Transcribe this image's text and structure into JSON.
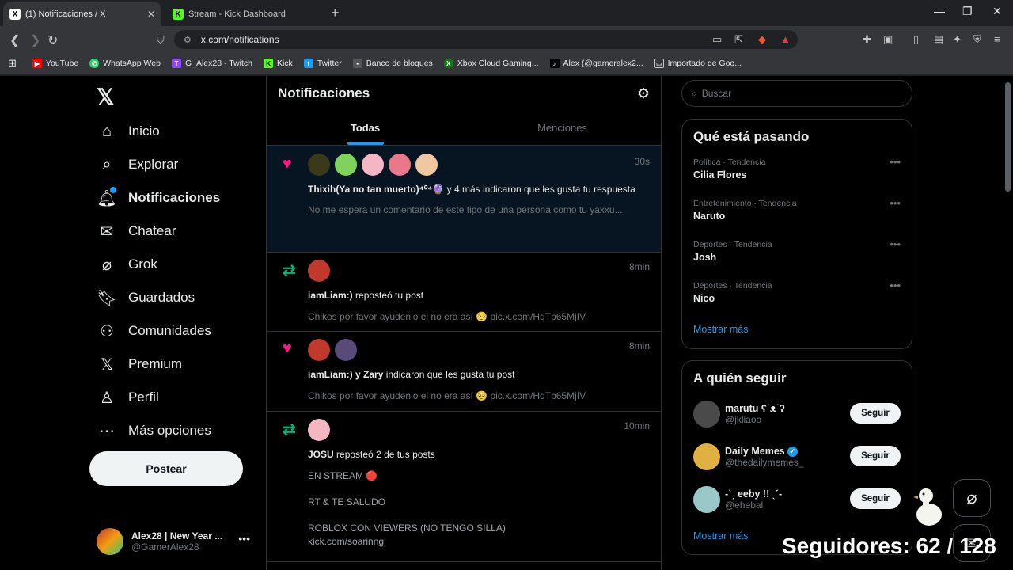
{
  "browser": {
    "tabs": [
      {
        "title": "(1) Notificaciones / X",
        "icon": "x-icon",
        "active": true
      },
      {
        "title": "Stream - Kick Dashboard",
        "icon": "kick-icon",
        "active": false
      }
    ],
    "url": "x.com/notifications",
    "bookmarks": [
      {
        "label": "YouTube",
        "icon": "youtube-icon",
        "color": "#ff0000"
      },
      {
        "label": "WhatsApp Web",
        "icon": "whatsapp-icon",
        "color": "#25d366"
      },
      {
        "label": "G_Alex28 - Twitch",
        "icon": "twitch-icon",
        "color": "#9146ff"
      },
      {
        "label": "Kick",
        "icon": "kick-icon",
        "color": "#53fc18"
      },
      {
        "label": "Twitter",
        "icon": "twitter-icon",
        "color": "#1d9bf0"
      },
      {
        "label": "Banco de bloques",
        "icon": "block-icon",
        "color": "#ffffff"
      },
      {
        "label": "Xbox Cloud Gaming...",
        "icon": "xbox-icon",
        "color": "#107c10"
      },
      {
        "label": "Alex (@gameralex2...",
        "icon": "tiktok-icon",
        "color": "#000000"
      },
      {
        "label": "Importado de Goo...",
        "icon": "folder-icon",
        "color": "#c4c7c5"
      }
    ]
  },
  "nav": {
    "items": [
      {
        "label": "Inicio",
        "icon": "home-icon"
      },
      {
        "label": "Explorar",
        "icon": "search-icon"
      },
      {
        "label": "Notificaciones",
        "icon": "bell-icon",
        "badge": "1"
      },
      {
        "label": "Chatear",
        "icon": "mail-icon"
      },
      {
        "label": "Grok",
        "icon": "grok-icon"
      },
      {
        "label": "Guardados",
        "icon": "bookmark-icon"
      },
      {
        "label": "Comunidades",
        "icon": "communities-icon"
      },
      {
        "label": "Premium",
        "icon": "x-icon"
      },
      {
        "label": "Perfil",
        "icon": "person-icon"
      },
      {
        "label": "Más opciones",
        "icon": "more-icon"
      }
    ],
    "post_label": "Postear",
    "account": {
      "name": "Alex28 | New Year ...",
      "handle": "@GamerAlex28"
    }
  },
  "main": {
    "title": "Notificaciones",
    "tabs": [
      "Todas",
      "Menciones"
    ],
    "notifications": [
      {
        "kind": "like",
        "time": "30s",
        "avatar_colors": [
          "#3a3a1a",
          "#7fd35a",
          "#f4b6c2",
          "#e8788a",
          "#f0c8a0"
        ],
        "actor": "Thixih(Ya no tan muerto)⁴⁰⁴🔮",
        "text": " y 4 más indicaron que les gusta tu respuesta",
        "sub": "No me espera un comentario de este tipo de una persona como tu yaxxu...",
        "unread": true
      },
      {
        "kind": "repost",
        "time": "8min",
        "avatar_colors": [
          "#c0392b"
        ],
        "actor": "iamLiam:)",
        "text": " reposteó tu post",
        "sub": "Chikos por favor ayúdenlo el no era así 🥺 pic.x.com/HqTp65MjIV",
        "unread": false
      },
      {
        "kind": "like",
        "time": "8min",
        "avatar_colors": [
          "#c0392b",
          "#5a4a7a"
        ],
        "actor": "iamLiam:) y Zary",
        "text": " indicaron que les gusta tu post",
        "sub": "Chikos por favor ayúdenlo el no era así 🥺 pic.x.com/HqTp65MjIV",
        "unread": false
      },
      {
        "kind": "repost",
        "time": "10min",
        "avatar_colors": [
          "#f4b6c2"
        ],
        "actor": "JOSU",
        "text": " reposteó 2 de tus posts",
        "sub_lines": [
          "EN STREAM 🔴",
          "RT & TE SALUDO",
          "ROBLOX CON VIEWERS (NO TENGO SILLA)",
          " kick.com/soarinng"
        ],
        "unread": false
      }
    ]
  },
  "right": {
    "search_placeholder": "Buscar",
    "trends_title": "Qué está pasando",
    "trends": [
      {
        "category": "Política · Tendencia",
        "name": "Cilia Flores"
      },
      {
        "category": "Entretenimiento · Tendencia",
        "name": "Naruto"
      },
      {
        "category": "Deportes · Tendencia",
        "name": "Josh"
      },
      {
        "category": "Deportes · Tendencia",
        "name": "Nico"
      }
    ],
    "show_more": "Mostrar más",
    "follow_title": "A quién seguir",
    "suggestions": [
      {
        "name": "marutu ʕ˙ᴥ˙ʔ",
        "handle": "@jkliaoo",
        "verified": false,
        "avatar": "#4a4a4a"
      },
      {
        "name": "Daily Memes",
        "handle": "@thedailymemes_",
        "verified": true,
        "avatar": "#e0b040"
      },
      {
        "name": "-ˋˏ eeby !! ˎˊ-",
        "handle": "@ehebal",
        "verified": false,
        "avatar": "#9ac8c8"
      }
    ],
    "follow_label": "Seguir",
    "show_more_2": "Mostrar más"
  },
  "overlay": {
    "followers": "Seguidores: 62 / 128"
  }
}
